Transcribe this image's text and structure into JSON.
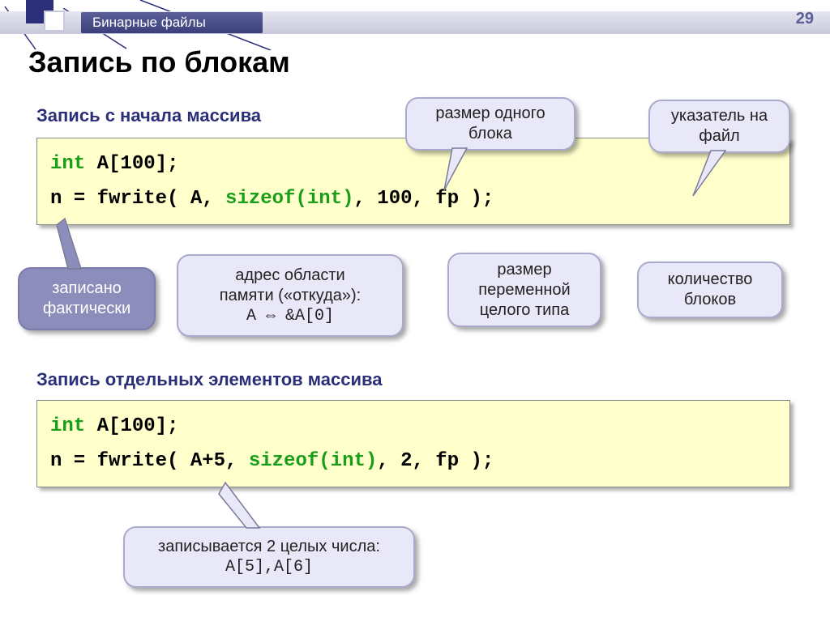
{
  "header": {
    "chapter": "Бинарные файлы",
    "page": "29"
  },
  "title": "Запись по блокам",
  "section1": {
    "heading": "Запись с начала массива",
    "code_line1_a": "int",
    "code_line1_b": " A[100];",
    "code_line2_a": "n = fwrite( A, ",
    "code_line2_b": "sizeof(int)",
    "code_line2_c": ", 100, fp );",
    "callouts": {
      "block_size": "размер одного блока",
      "file_ptr": "указатель на файл",
      "actual_written": "записано фактически",
      "mem_addr_l1": "адрес области",
      "mem_addr_l2": "памяти («откуда»):",
      "mem_addr_code_a": "A  ",
      "mem_addr_code_arrow": "⇔",
      "mem_addr_code_b": "  &A[0]",
      "int_size_l1": "размер",
      "int_size_l2": "переменной",
      "int_size_l3": "целого типа",
      "block_count_l1": "количество",
      "block_count_l2": "блоков"
    }
  },
  "section2": {
    "heading": "Запись отдельных элементов массива",
    "code_line1_a": "int",
    "code_line1_b": " A[100];",
    "code_line2_a": "n = fwrite( A+5, ",
    "code_line2_b": "sizeof(int)",
    "code_line2_c": ", 2, fp );",
    "callouts": {
      "writes_l1": "записывается 2 целых числа:",
      "writes_code": "A[5],A[6]"
    }
  }
}
